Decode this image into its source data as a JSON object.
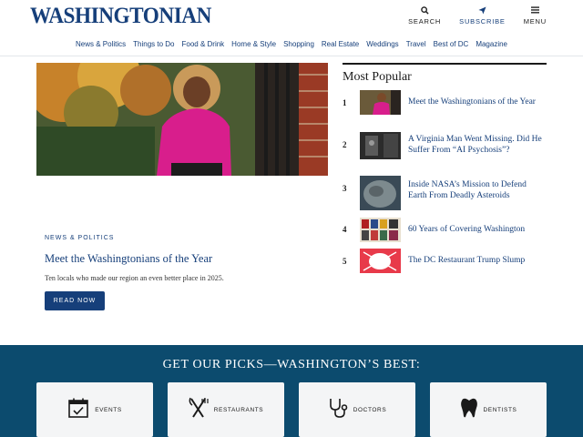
{
  "header": {
    "logo": "WASHINGTONIAN",
    "actions": {
      "search": "SEARCH",
      "subscribe": "SUBSCRIBE",
      "menu": "MENU"
    }
  },
  "nav": {
    "items": [
      "News & Politics",
      "Things to Do",
      "Food & Drink",
      "Home & Style",
      "Shopping",
      "Real Estate",
      "Weddings",
      "Travel",
      "Best of DC",
      "Magazine"
    ]
  },
  "feature": {
    "kicker": "NEWS & POLITICS",
    "title": "Meet the Washingtonians of the Year",
    "dek": "Ten locals who made our region an even better place in 2025.",
    "button": "READ NOW"
  },
  "popular": {
    "heading": "Most Popular",
    "items": [
      {
        "num": "1",
        "title": "Meet the Washingtonians of the Year"
      },
      {
        "num": "2",
        "title": "A Virginia Man Went Missing. Did He Suffer From “AI Psychosis”?"
      },
      {
        "num": "3",
        "title": "Inside NASA’s Mission to Defend Earth From Deadly Asteroids"
      },
      {
        "num": "4",
        "title": "60 Years of Covering Washington"
      },
      {
        "num": "5",
        "title": "The DC Restaurant Trump Slump"
      }
    ]
  },
  "picks": {
    "heading": "GET OUR PICKS—WASHINGTON’S BEST:",
    "items": [
      {
        "label": "EVENTS",
        "icon": "calendar-icon"
      },
      {
        "label": "RESTAURANTS",
        "icon": "fork-knife-icon"
      },
      {
        "label": "DOCTORS",
        "icon": "stethoscope-icon"
      },
      {
        "label": "DENTISTS",
        "icon": "tooth-icon"
      }
    ]
  },
  "colors": {
    "brand": "#163f7a",
    "band": "#0c4b6e",
    "card": "#f4f5f6"
  }
}
